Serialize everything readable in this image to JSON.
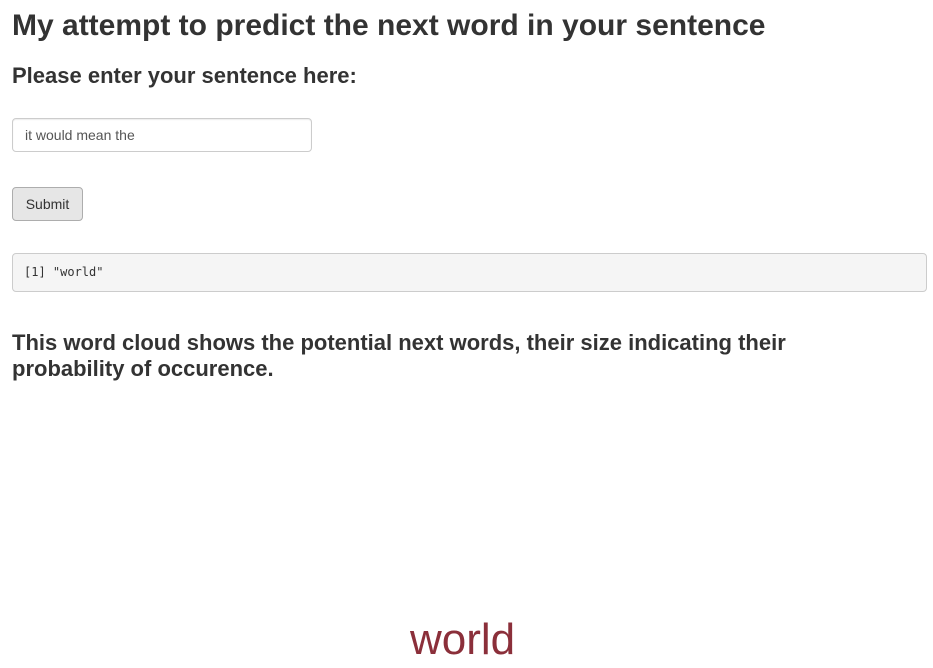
{
  "header": {
    "title": "My attempt to predict the next word in your sentence"
  },
  "form": {
    "heading": "Please enter your sentence here:",
    "sentence_value": "it would mean the",
    "submit_label": "Submit"
  },
  "output": {
    "text": "[1] \"world\""
  },
  "cloud": {
    "heading": "This word cloud shows the potential next words, their size indicating their probability of occurence.",
    "words": [
      {
        "text": "world",
        "color": "#8b2f3a"
      }
    ]
  }
}
